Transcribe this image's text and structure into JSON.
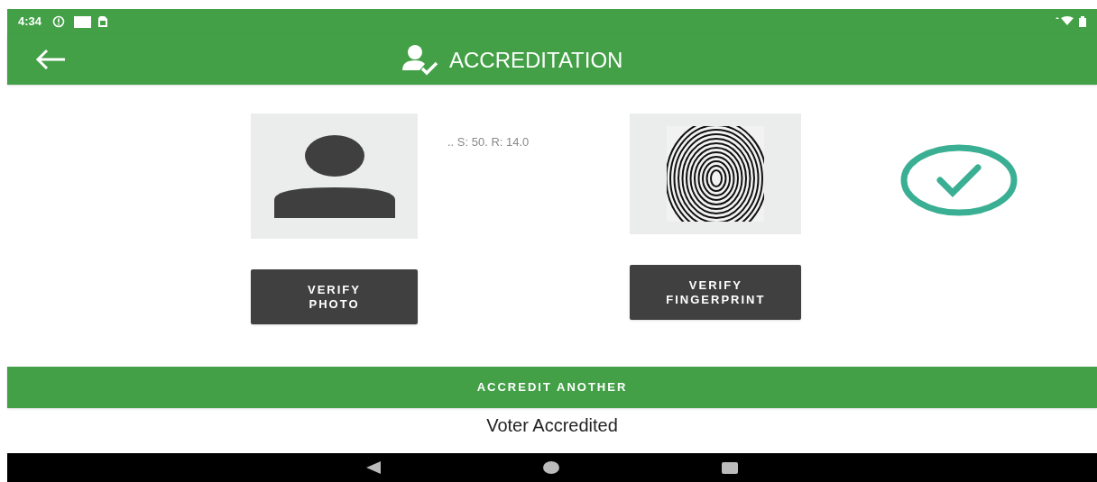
{
  "status_bar": {
    "time": "4:34"
  },
  "app_bar": {
    "title": "ACCREDITATION"
  },
  "photo_panel": {
    "button": "VERIFY\nPHOTO"
  },
  "score": ".. S: 50. R: 14.0",
  "fingerprint_panel": {
    "kind": "picture",
    "button": "VERIFY\nFINGERPRINT"
  },
  "result": {
    "verified": true
  },
  "accredit_button": "ACCREDIT ANOTHER",
  "status_message": "Voter Accredited"
}
